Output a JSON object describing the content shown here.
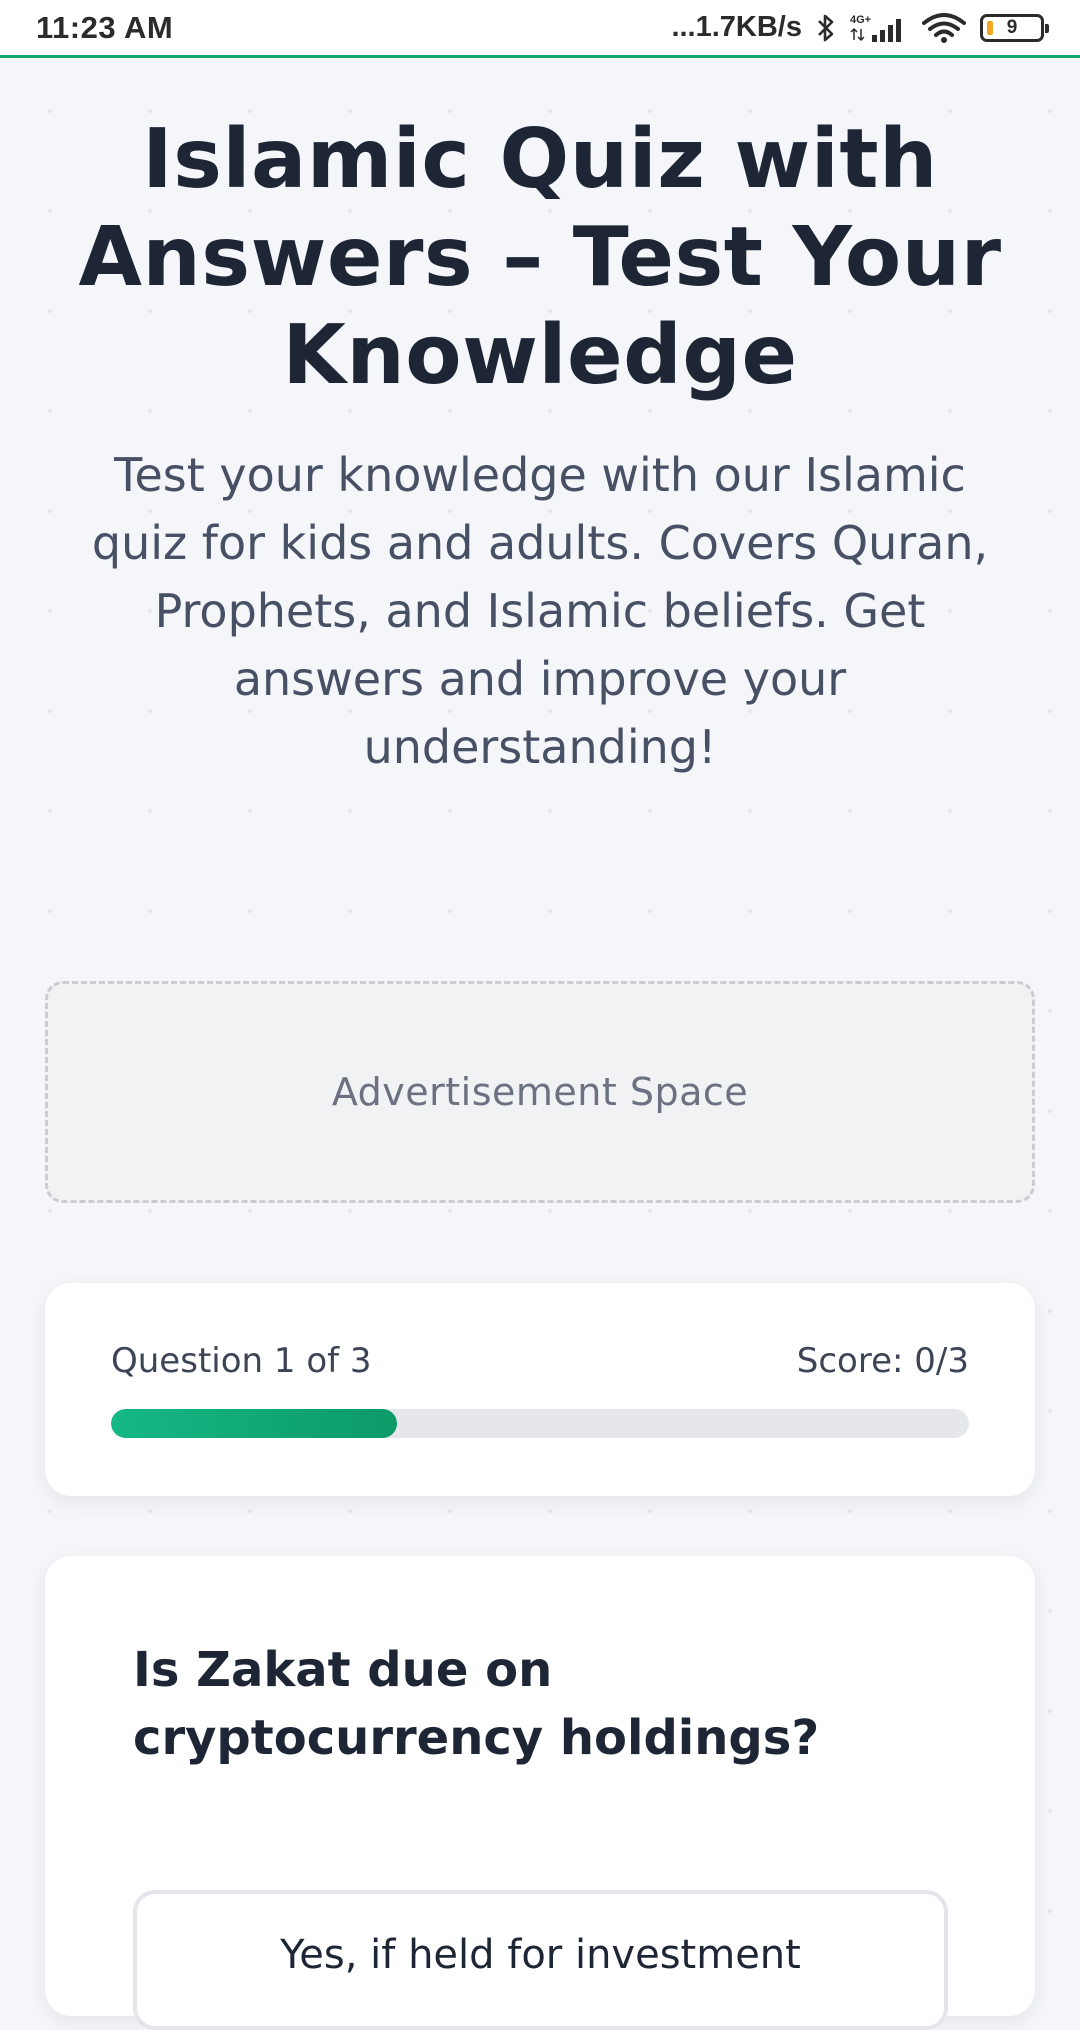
{
  "status_bar": {
    "time": "11:23 AM",
    "network_speed": "...1.7KB/s",
    "network_type": "4G+",
    "battery_level": "9",
    "icons": [
      "bluetooth-icon",
      "signal-icon",
      "wifi-icon",
      "battery-icon"
    ]
  },
  "hero": {
    "title": "Islamic Quiz with Answers – Test Your Knowledge",
    "subtitle": "Test your knowledge with our Islamic quiz for kids and adults. Covers Quran, Prophets, and Islamic beliefs. Get answers and improve your understanding!"
  },
  "ad": {
    "label": "Advertisement Space"
  },
  "progress": {
    "question_label": "Question 1 of 3",
    "score_label": "Score: 0/3",
    "fraction": 0.333,
    "accent": "#10b07c"
  },
  "question": {
    "text": "Is Zakat due on cryptocurrency holdings?",
    "options": [
      "Yes, if held for investment"
    ]
  }
}
